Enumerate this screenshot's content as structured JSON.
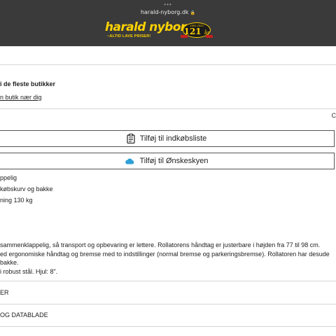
{
  "browser": {
    "dots": "•••",
    "url": "harald-nyborg.dk",
    "lock_glyph": "🔒"
  },
  "logo": {
    "name": "harald nyborg",
    "tagline": "~ALTID LAVE PRISER!",
    "badge_years": "1902-2023",
    "badge_number": "121",
    "badge_unit": "år"
  },
  "availability": {
    "stock_text": "i de fleste butikker",
    "store_link": "n butik nær dig",
    "right_clip": "C"
  },
  "actions": {
    "shopping_list": "Tilføj til indkøbsliste",
    "wishlist": "Tilføj til Ønskeskyen"
  },
  "features": [
    "ppelig",
    "købskurv og bakke",
    "ning 130 kg"
  ],
  "description": [
    " sammenklappelig, så transport og opbevaring er lettere. Rollatorens håndtag er justerbare i højden fra 77 til 98 cm.",
    "ed ergonomiske håndtag og bremse med to indstillinger (normal bremse og parkeringsbremse). Rollatoren har desude",
    "bakke.",
    " i robust stål. Hjul: 8\"."
  ],
  "accordions": [
    "ER",
    "OG DATABLADE"
  ],
  "colors": {
    "topbar": "#3a3a3a",
    "brand_yellow": "#ffd200",
    "divider": "#d6d6d6",
    "cloud_blue": "#2e9fd6"
  }
}
